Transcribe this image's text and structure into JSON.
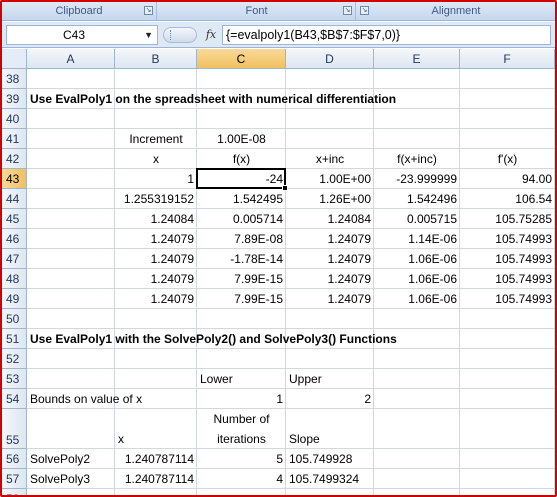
{
  "ribbon": {
    "groups": [
      {
        "label": "Clipboard"
      },
      {
        "label": "Font"
      },
      {
        "label": "Alignment"
      }
    ],
    "launcher_glyph": "↘"
  },
  "formula_bar": {
    "name_box": "C43",
    "fx_label": "fx",
    "formula": "{=evalpoly1(B43,$B$7:$F$7,0)}"
  },
  "columns": [
    "A",
    "B",
    "C",
    "D",
    "E",
    "F"
  ],
  "selected_column": "C",
  "selected_row": "43",
  "rows": [
    {
      "num": "38",
      "cells": []
    },
    {
      "num": "39",
      "cells": [
        {
          "col": "A",
          "text": "Use EvalPoly1 on the spreadsheet with numerical differentiation",
          "bold": true,
          "align": "l"
        }
      ]
    },
    {
      "num": "40",
      "cells": []
    },
    {
      "num": "41",
      "cells": [
        {
          "col": "B",
          "text": "Increment",
          "align": "c"
        },
        {
          "col": "C",
          "text": "1.00E-08",
          "align": "c"
        }
      ]
    },
    {
      "num": "42",
      "cells": [
        {
          "col": "B",
          "text": "x",
          "align": "c"
        },
        {
          "col": "C",
          "text": "f(x)",
          "align": "c"
        },
        {
          "col": "D",
          "text": "x+inc",
          "align": "c"
        },
        {
          "col": "E",
          "text": "f(x+inc)",
          "align": "c"
        },
        {
          "col": "F",
          "text": "f'(x)",
          "align": "c"
        }
      ]
    },
    {
      "num": "43",
      "cells": [
        {
          "col": "B",
          "text": "1",
          "align": "r"
        },
        {
          "col": "C",
          "text": "-24",
          "align": "r"
        },
        {
          "col": "D",
          "text": "1.00E+00",
          "align": "r"
        },
        {
          "col": "E",
          "text": "-23.999999",
          "align": "r"
        },
        {
          "col": "F",
          "text": "94.00",
          "align": "r"
        }
      ]
    },
    {
      "num": "44",
      "cells": [
        {
          "col": "B",
          "text": "1.255319152",
          "align": "r"
        },
        {
          "col": "C",
          "text": "1.542495",
          "align": "r"
        },
        {
          "col": "D",
          "text": "1.26E+00",
          "align": "r"
        },
        {
          "col": "E",
          "text": "1.542496",
          "align": "r"
        },
        {
          "col": "F",
          "text": "106.54",
          "align": "r"
        }
      ]
    },
    {
      "num": "45",
      "cells": [
        {
          "col": "B",
          "text": "1.24084",
          "align": "r"
        },
        {
          "col": "C",
          "text": "0.005714",
          "align": "r"
        },
        {
          "col": "D",
          "text": "1.24084",
          "align": "r"
        },
        {
          "col": "E",
          "text": "0.005715",
          "align": "r"
        },
        {
          "col": "F",
          "text": "105.75285",
          "align": "r"
        }
      ]
    },
    {
      "num": "46",
      "cells": [
        {
          "col": "B",
          "text": "1.24079",
          "align": "r"
        },
        {
          "col": "C",
          "text": "7.89E-08",
          "align": "r"
        },
        {
          "col": "D",
          "text": "1.24079",
          "align": "r"
        },
        {
          "col": "E",
          "text": "1.14E-06",
          "align": "r"
        },
        {
          "col": "F",
          "text": "105.74993",
          "align": "r"
        }
      ]
    },
    {
      "num": "47",
      "cells": [
        {
          "col": "B",
          "text": "1.24079",
          "align": "r"
        },
        {
          "col": "C",
          "text": "-1.78E-14",
          "align": "r"
        },
        {
          "col": "D",
          "text": "1.24079",
          "align": "r"
        },
        {
          "col": "E",
          "text": "1.06E-06",
          "align": "r"
        },
        {
          "col": "F",
          "text": "105.74993",
          "align": "r"
        }
      ]
    },
    {
      "num": "48",
      "cells": [
        {
          "col": "B",
          "text": "1.24079",
          "align": "r"
        },
        {
          "col": "C",
          "text": "7.99E-15",
          "align": "r"
        },
        {
          "col": "D",
          "text": "1.24079",
          "align": "r"
        },
        {
          "col": "E",
          "text": "1.06E-06",
          "align": "r"
        },
        {
          "col": "F",
          "text": "105.74993",
          "align": "r"
        }
      ]
    },
    {
      "num": "49",
      "cells": [
        {
          "col": "B",
          "text": "1.24079",
          "align": "r"
        },
        {
          "col": "C",
          "text": "7.99E-15",
          "align": "r"
        },
        {
          "col": "D",
          "text": "1.24079",
          "align": "r"
        },
        {
          "col": "E",
          "text": "1.06E-06",
          "align": "r"
        },
        {
          "col": "F",
          "text": "105.74993",
          "align": "r"
        }
      ]
    },
    {
      "num": "50",
      "cells": []
    },
    {
      "num": "51",
      "cells": [
        {
          "col": "A",
          "text": "Use EvalPoly1 with the SolvePoly2() and SolvePoly3() Functions",
          "bold": true,
          "align": "l"
        }
      ]
    },
    {
      "num": "52",
      "cells": []
    },
    {
      "num": "53",
      "cells": [
        {
          "col": "C",
          "text": "Lower",
          "align": "l"
        },
        {
          "col": "D",
          "text": "Upper",
          "align": "l"
        }
      ]
    },
    {
      "num": "54",
      "cells": [
        {
          "col": "A",
          "text": "Bounds on value of x",
          "align": "l"
        },
        {
          "col": "C",
          "text": "1",
          "align": "r"
        },
        {
          "col": "D",
          "text": "2",
          "align": "r"
        }
      ]
    },
    {
      "num": "55",
      "tall": true,
      "cells": [
        {
          "col": "B",
          "text": "x",
          "align": "l"
        },
        {
          "col": "C",
          "text": "Number of",
          "text2": "iterations",
          "align": "c"
        },
        {
          "col": "D",
          "text": "Slope",
          "align": "l"
        }
      ]
    },
    {
      "num": "56",
      "cells": [
        {
          "col": "A",
          "text": "SolvePoly2",
          "align": "l"
        },
        {
          "col": "B",
          "text": "1.240787114",
          "align": "r"
        },
        {
          "col": "C",
          "text": "5",
          "align": "r"
        },
        {
          "col": "D",
          "text": "105.749928",
          "align": "l"
        }
      ]
    },
    {
      "num": "57",
      "cells": [
        {
          "col": "A",
          "text": "SolvePoly3",
          "align": "l"
        },
        {
          "col": "B",
          "text": "1.240787114",
          "align": "r"
        },
        {
          "col": "C",
          "text": "4",
          "align": "r"
        },
        {
          "col": "D",
          "text": "105.7499324",
          "align": "l"
        }
      ]
    },
    {
      "num": "58",
      "cells": []
    }
  ],
  "active_cell": {
    "col": "C",
    "row": "43"
  }
}
